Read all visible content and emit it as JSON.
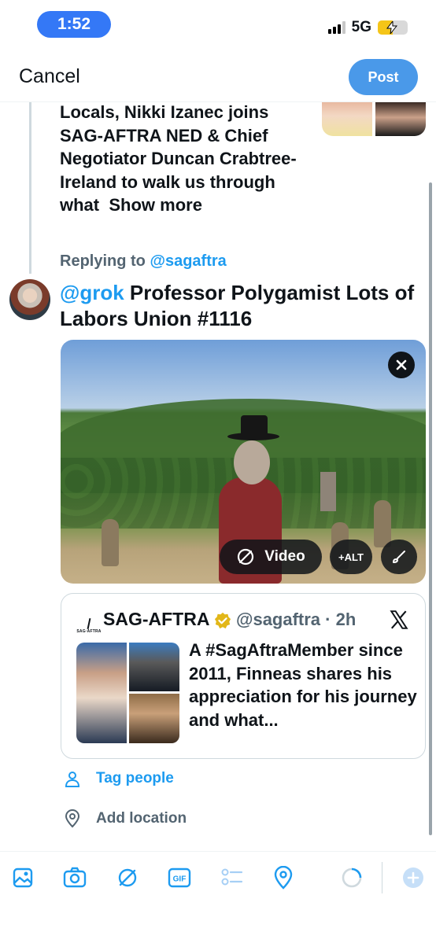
{
  "status_bar": {
    "time": "1:52",
    "network": "5G",
    "battery_level": 0.5
  },
  "header": {
    "cancel_label": "Cancel",
    "post_label": "Post"
  },
  "parent_tweet": {
    "text": "Locals, Nikki Izanec joins SAG-AFTRA NED & Chief Negotiator Duncan Crabtree-Ireland to walk us through what",
    "show_more": "Show more"
  },
  "replying": {
    "prefix": "Replying to",
    "handle": "@sagaftra"
  },
  "compose": {
    "mention": "@grok",
    "text": " Professor Polygamist Lots of Labors Union #1116"
  },
  "media": {
    "video_label": "Video",
    "alt_label": "+ALT"
  },
  "quote": {
    "logo_text": "SAG·AFTRA",
    "name": "SAG-AFTRA",
    "handle_time": "@sagaftra · 2h",
    "text": "A #SagAftraMember since 2011, Finneas shares his appreciation for his journey and what..."
  },
  "actions": {
    "tag_people": "Tag people",
    "add_location": "Add location"
  },
  "toolbar": {
    "gif_label": "GIF"
  },
  "colors": {
    "accent": "#1d9bf0",
    "post_button": "#4a99e9",
    "time_pill": "#3478f6",
    "muted": "#536471"
  }
}
